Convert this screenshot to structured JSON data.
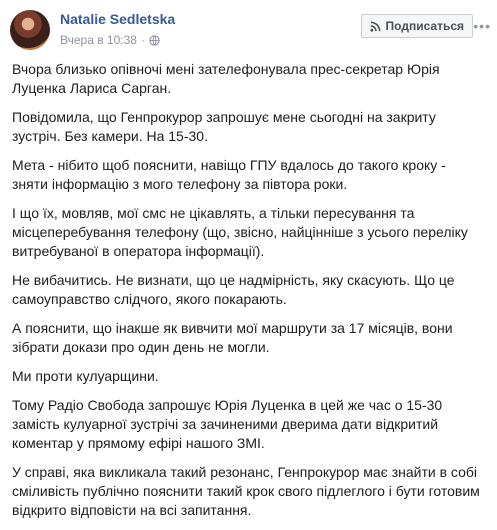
{
  "post": {
    "author": "Natalie Sedletska",
    "timestamp": "Вчера в 10:38",
    "privacy_icon": "globe-icon",
    "follow_label": "Подписаться",
    "follow_icon": "rss-icon",
    "more_icon": "more-options-icon",
    "paragraphs": [
      "Вчора близько опівночі мені зателефонувала прес-секретар Юрія Луценка Лариса Сарган.",
      "Повідомила, що Генпрокурор запрошує мене сьогодні на закриту зустріч. Без камери. На 15-30.",
      "Мета - нібито щоб пояснити, навіщо ГПУ вдалось до такого кроку - зняти інформацію з мого телефону за півтора роки.",
      "І щo їх, мовляв, мої смс не цікавлять, а тільки пересування та місцеперебування телефону (що, звісно, найцінніше з усього переліку витребуваної в оператора інформації).",
      "Не вибачитись. Не визнати, що це надмірність, яку скасують. Що це самоуправство слідчого, якого покарають.",
      "А пояснити, що інакше як вивчити мої маршрути за 17 місяців, вони зібрати докази про один день не могли.",
      "Ми проти кулуарщини.",
      "Тому Радіо Свобода запрошує Юрія Луценка в цей же час о 15-30 замість кулуарної зустрічі за зачиненими дверима дати відкритий коментар у прямому ефірі нашого ЗМІ.",
      "У справі, яка викликала такий резонанс, Генпрокурор має знайти в собі сміливість публічно пояснити такий крок свого підлеглого і бути готовим відкрито відповісти на всі запитання."
    ]
  }
}
